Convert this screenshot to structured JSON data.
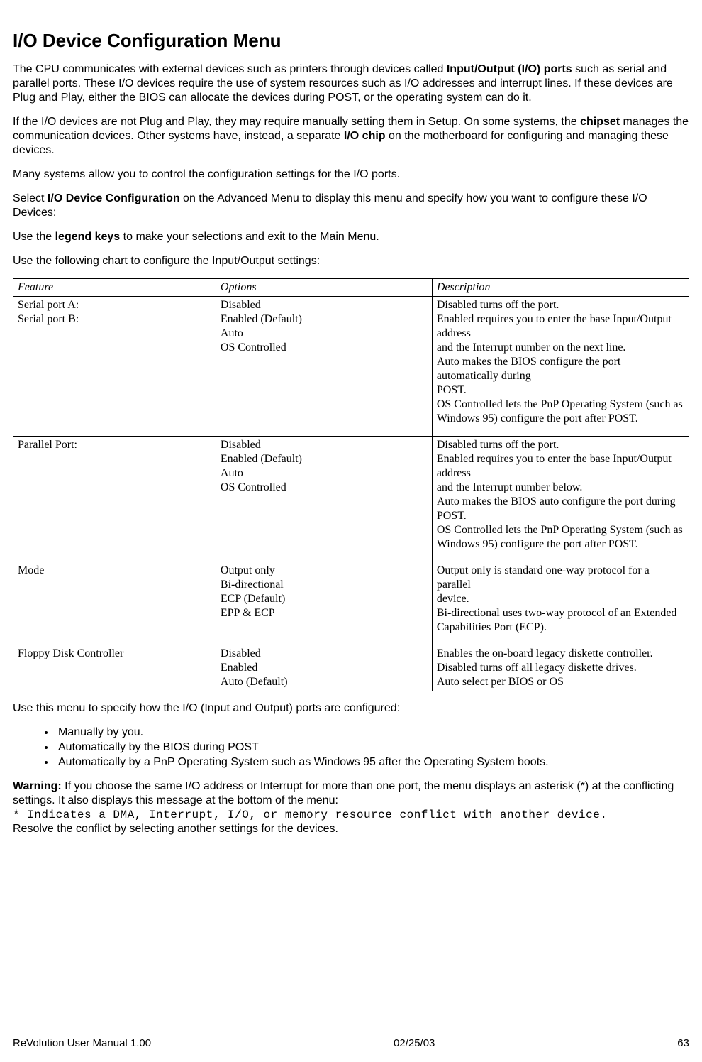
{
  "title": "I/O Device Configuration Menu",
  "para1": {
    "a": "The CPU communicates with external devices such as printers through devices called ",
    "b": "Input/Output (I/O) ports",
    "c": " such as serial and parallel ports. These I/O devices require the use of system resources such as I/O addresses and interrupt lines. If these devices are Plug and Play, either the BIOS can allocate the devices during POST, or the operating system can do it."
  },
  "para2": {
    "a": "If the I/O devices are not Plug and Play, they may require manually setting them in Setup. On some systems, the ",
    "b": "chipset",
    "c": " manages the communication devices. Other systems have, instead, a separate ",
    "d": "I/O chip",
    "e": " on the motherboard for configuring and managing these devices."
  },
  "para3": "Many systems allow you to control the configuration settings for the I/O ports.",
  "para4": {
    "a": "Select ",
    "b": "I/O Device Configuration",
    "c": " on the Advanced Menu to display this menu and specify how you want to configure these I/O Devices:"
  },
  "para5": {
    "a": "Use the ",
    "b": "legend keys",
    "c": " to make your selections and exit to the Main Menu."
  },
  "para6": "Use the following chart to configure the Input/Output settings:",
  "table": {
    "headers": {
      "feature": "Feature",
      "options": "Options",
      "description": "Description"
    },
    "rows": [
      {
        "feature": [
          "Serial port A:",
          "Serial port B:"
        ],
        "options": [
          "Disabled",
          "Enabled (Default)",
          "Auto",
          "OS Controlled"
        ],
        "description": [
          "Disabled turns off the port.",
          "Enabled requires you to enter the base Input/Output address",
          "and the Interrupt number on the next line.",
          "Auto makes the BIOS configure the port automatically during",
          "POST.",
          "OS Controlled lets the PnP Operating System (such as",
          "Windows 95) configure the port after POST."
        ]
      },
      {
        "feature": [
          "Parallel Port:"
        ],
        "options": [
          "Disabled",
          "Enabled (Default)",
          "Auto",
          "OS Controlled"
        ],
        "description": [
          "Disabled turns off the port.",
          "Enabled requires you to enter the base Input/Output address",
          "and the Interrupt number below.",
          "Auto makes the BIOS auto configure the port during POST.",
          "OS Controlled lets the PnP Operating System (such as",
          "Windows 95) configure the port after POST."
        ]
      },
      {
        "feature": [
          "Mode"
        ],
        "options": [
          "Output only",
          "Bi-directional",
          "ECP (Default)",
          "EPP & ECP"
        ],
        "description": [
          "Output only is standard one-way protocol for a parallel",
          "device.",
          "Bi-directional uses two-way protocol of an Extended",
          "Capabilities Port (ECP)."
        ]
      },
      {
        "feature": [
          "Floppy Disk Controller"
        ],
        "options": [
          "Disabled",
          "Enabled",
          "Auto (Default)"
        ],
        "description": [
          "Enables the on-board legacy diskette controller.",
          "Disabled turns off all legacy diskette drives.",
          "Auto select per BIOS or OS"
        ]
      }
    ]
  },
  "after_table_intro": "Use this menu to specify how the I/O (Input and Output) ports are configured:",
  "bullets": [
    "Manually by you.",
    "Automatically by the BIOS during POST",
    "Automatically by a PnP Operating System such as Windows 95 after the Operating System boots."
  ],
  "warning": {
    "label": "Warning:",
    "a": " If you choose the same I/O address or Interrupt for more than one port, the menu displays an asterisk (*) at the conflicting settings. It also displays this message at the bottom of the menu:",
    "mono": "* Indicates a DMA, Interrupt, I/O, or memory resource conflict with another device.",
    "b": "Resolve the conflict by selecting another settings for the devices."
  },
  "footer": {
    "left": "ReVolution User Manual 1.00",
    "center": "02/25/03",
    "right": "63"
  }
}
